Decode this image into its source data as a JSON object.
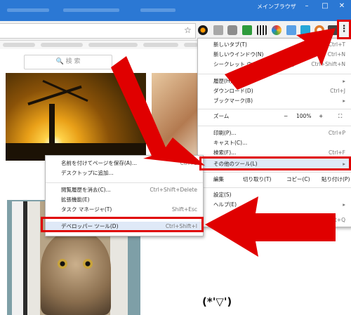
{
  "window": {
    "title": "メインブラウザ",
    "minimize": "–",
    "maximize": "□",
    "close": "✕"
  },
  "toolbar": {
    "star_icon": "star-icon",
    "more_icon": "⋮"
  },
  "page": {
    "search_placeholder": "🔍 検 索",
    "emoticon": "(*'▽')"
  },
  "main_menu": {
    "items": [
      {
        "label": "新しいタブ(T)",
        "shortcut": "Ctrl+T"
      },
      {
        "label": "新しいウインドウ(N)",
        "shortcut": "Ctrl+N"
      },
      {
        "label": "シークレット ウインドウを開く(I)",
        "shortcut": "Ctrl+Shift+N"
      },
      {
        "label": "履歴(H)",
        "shortcut": ""
      },
      {
        "label": "ダウンロード(D)",
        "shortcut": "Ctrl+J"
      },
      {
        "label": "ブックマーク(B)",
        "shortcut": ""
      },
      {
        "label": "印刷(P)...",
        "shortcut": "Ctrl+P"
      },
      {
        "label": "キャスト(C)...",
        "shortcut": ""
      },
      {
        "label": "検索(F)...",
        "shortcut": "Ctrl+F"
      },
      {
        "label": "その他のツール(L)",
        "shortcut": ""
      },
      {
        "label": "設定(S)",
        "shortcut": ""
      },
      {
        "label": "ヘルプ(E)",
        "shortcut": ""
      }
    ],
    "zoom": {
      "label": "ズーム",
      "minus": "−",
      "value": "100%",
      "plus": "+",
      "fullscreen": "⛶"
    },
    "edit": {
      "label": "編集",
      "cut": "切り取り(T)",
      "copy": "コピー(C)",
      "paste": "貼り付け(P)"
    },
    "partial_shortcut": "Shift+Q"
  },
  "sub_menu": {
    "items": [
      {
        "label": "名前を付けてページを保存(A)...",
        "shortcut": "Ctrl+S"
      },
      {
        "label": "デスクトップに追加...",
        "shortcut": ""
      },
      {
        "label": "閲覧履歴を消去(C)...",
        "shortcut": "Ctrl+Shift+Delete"
      },
      {
        "label": "拡張機能(E)",
        "shortcut": ""
      },
      {
        "label": "タスク マネージャ(T)",
        "shortcut": "Shift+Esc"
      },
      {
        "label": "デベロッパー ツール(D)",
        "shortcut": "Ctrl+Shift+I"
      }
    ]
  },
  "colors": {
    "titlebar": "#2b78d4",
    "highlight_red": "#e00000",
    "arrow_red": "#e00000",
    "menu_highlight": "#dfe9f7"
  }
}
